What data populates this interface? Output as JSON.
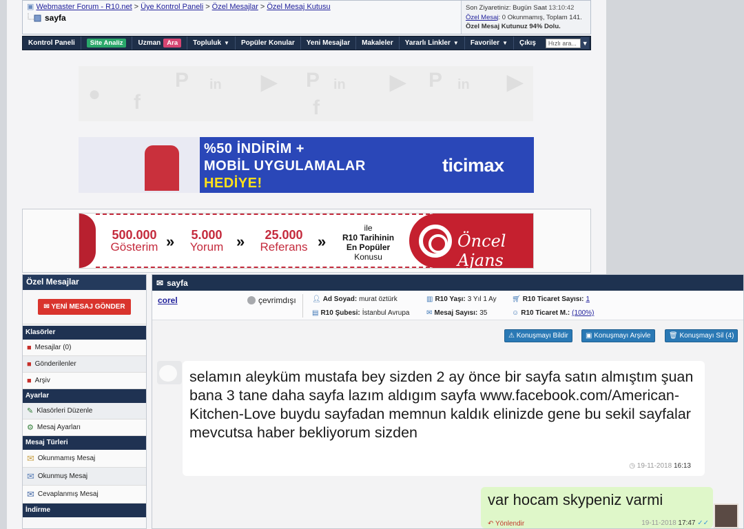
{
  "breadcrumb": {
    "items": [
      "Webmaster Forum - R10.net",
      "Üye Kontrol Paneli",
      "Özel Mesajlar",
      "Özel Mesaj Kutusu"
    ],
    "separator": ">",
    "current": "sayfa"
  },
  "user_box": {
    "last_visit_label": "Son Ziyaretiniz:",
    "last_visit_value": "Bugün Saat",
    "last_visit_time": "13:10:42",
    "pm_link": "Özel Mesaj",
    "pm_stats": ": 0 Okunmamış, Toplam 141.",
    "inbox_full": "Özel Mesaj Kutunuz 94% Dolu."
  },
  "navbar": {
    "items": [
      "Kontrol Paneli",
      "Site Analiz",
      "Uzman",
      "Ara",
      "Topluluk",
      "Popüler Konular",
      "Yeni Mesajlar",
      "Makaleler",
      "Yararlı Linkler",
      "Favoriler",
      "Çıkış"
    ],
    "search_placeholder": "Hızlı ara..."
  },
  "ads": {
    "ticimax": {
      "line1": "%50 İNDİRİM +",
      "line2": "MOBİL UYGULAMALAR",
      "line3": "HEDİYE!",
      "logo": "ticimax"
    },
    "oncel": {
      "stats": [
        {
          "num": "500.000",
          "label": "Gösterim"
        },
        {
          "num": "5.000",
          "label": "Yorum"
        },
        {
          "num": "25.000",
          "label": "Referans"
        }
      ],
      "center_1": "ile",
      "center_2": "R10 Tarihinin",
      "center_3": "En Popüler",
      "center_4": "Konusu",
      "brand": "Öncel Ajans"
    }
  },
  "sidebar": {
    "title": "Özel Mesajlar",
    "new_message": "YENİ MESAJ GÖNDER",
    "sections": {
      "folders": "Klasörler",
      "settings": "Ayarlar",
      "types": "Mesaj Türleri",
      "download": "İndirme"
    },
    "folders": [
      "Mesajlar (0)",
      "Gönderilenler",
      "Arşiv"
    ],
    "settings": [
      "Klasörleri Düzenle",
      "Mesaj Ayarları"
    ],
    "types": [
      "Okunmamış Mesaj",
      "Okunmuş Mesaj",
      "Cevaplanmış Mesaj"
    ]
  },
  "conversation": {
    "title": "sayfa",
    "user": "corel",
    "status": "çevrimdışı",
    "fields": {
      "name_label": "Ad Soyad:",
      "name_value": "murat öztürk",
      "age_label": "R10 Yaşı:",
      "age_value": "3 Yıl 1 Ay",
      "trade_count_label": "R10 Ticaret Sayısı:",
      "trade_count_value": "1",
      "branch_label": "R10 Şubesi:",
      "branch_value": "İstanbul Avrupa",
      "msg_count_label": "Mesaj Sayısı:",
      "msg_count_value": "35",
      "trade_m_label": "R10 Ticaret M.:",
      "trade_m_value": "(100%)"
    },
    "actions": {
      "report": "Konuşmayı Bildir",
      "archive": "Konuşmayı Arşivle",
      "delete": "Konuşmayı Sil (4)"
    },
    "messages": [
      {
        "text": "selamın aleyküm mustafa bey sizden 2 ay önce bir sayfa satın almıştım şuan bana 3 tane daha sayfa lazım aldıgım sayfa www.facebook.com/American-Kitchen-Love buydu sayfadan memnun kaldık elinizde gene bu sekil sayfalar mevcutsa haber bekliyorum sizden",
        "date": "19-11-2018",
        "time": "16:13"
      },
      {
        "text": "var hocam skypeniz varmi",
        "reply_label": "Yönlendir",
        "date": "19-11-2018",
        "time": "17:47"
      }
    ]
  }
}
